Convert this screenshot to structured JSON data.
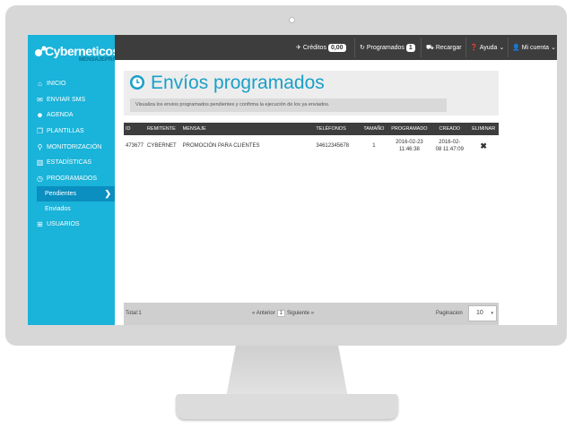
{
  "brand": {
    "name": "Cyberneticos",
    "sub": "MENSAJEPRO"
  },
  "topbar": {
    "credits_label": "Créditos",
    "credits_value": "0,00",
    "scheduled_label": "Programados",
    "scheduled_count": "1",
    "recharge_label": "Recargar",
    "help_label": "Ayuda",
    "account_label": "Mi cuenta"
  },
  "sidebar": {
    "items": [
      {
        "label": "Inicio",
        "icon": "home-icon"
      },
      {
        "label": "Enviar SMS",
        "icon": "envelope-icon"
      },
      {
        "label": "Agenda",
        "icon": "users-icon"
      },
      {
        "label": "Plantillas",
        "icon": "copy-icon"
      },
      {
        "label": "Monitorización",
        "icon": "search-icon"
      },
      {
        "label": "Estadísticas",
        "icon": "bar-chart-icon"
      },
      {
        "label": "Programados",
        "icon": "clock-icon"
      }
    ],
    "sub_items": [
      {
        "label": "Pendientes"
      },
      {
        "label": "Enviados"
      }
    ],
    "last_item": {
      "label": "Usuarios",
      "icon": "sitemap-icon"
    }
  },
  "page": {
    "title": "Envíos programados",
    "description": "Visualiza los envios programados pendientes y confirma la ejecución de los ya enviados."
  },
  "table": {
    "headers": [
      "ID",
      "Remitente",
      "Mensaje",
      "Teléfonos",
      "Tamaño",
      "Programado",
      "Creado",
      "Eliminar"
    ],
    "rows": [
      {
        "id": "473677",
        "sender": "CYBERNET",
        "message": "PROMOCIÓN PARA CLIENTES",
        "phones": "34612345678",
        "size": "1",
        "scheduled_date": "2016-02-23",
        "scheduled_time": "11:46:38",
        "created_date": "2016-02-",
        "created_time": "08 11:47:09"
      }
    ]
  },
  "footer": {
    "total": "Total:1",
    "prev": "Anterior",
    "page": "1",
    "next": "Siguiente",
    "pagination_label": "Paginacion",
    "page_size": "10"
  },
  "colors": {
    "accent": "#1ab3d9",
    "title": "#1aa0c8",
    "dark": "#3d3d3d"
  }
}
